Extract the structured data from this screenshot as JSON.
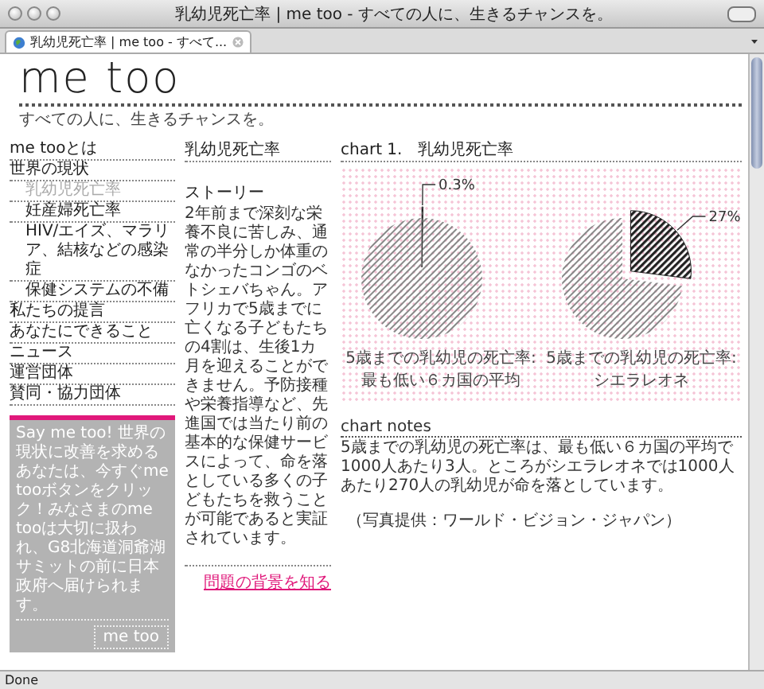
{
  "window": {
    "title": "乳幼児死亡率 | me too - すべての人に、生きるチャンスを。"
  },
  "tabs": [
    {
      "label": "乳幼児死亡率 | me too - すべて...",
      "selected": true
    }
  ],
  "header": {
    "logo": "me too",
    "tagline": "すべての人に、生きるチャンスを。"
  },
  "nav": [
    {
      "label": "me tooとは",
      "selected": false
    },
    {
      "label": "世界の現状",
      "selected": false,
      "children": [
        {
          "label": "乳幼児死亡率",
          "selected": true
        },
        {
          "label": "妊産婦死亡率",
          "selected": false
        },
        {
          "label": "HIV/エイズ、マラリア、結核などの感染症",
          "selected": false
        },
        {
          "label": "保健システムの不備",
          "selected": false
        }
      ]
    },
    {
      "label": "私たちの提言",
      "selected": false
    },
    {
      "label": "あなたにできること",
      "selected": false
    },
    {
      "label": "ニュース",
      "selected": false
    },
    {
      "label": "運営団体",
      "selected": false
    },
    {
      "label": "賛同・協力団体",
      "selected": false
    }
  ],
  "sidebar_box": {
    "text": "Say me too! 世界の現状に改善を求めるあなたは、今すぐme tooボタンをクリック！みなさまのme tooは大切に扱われ、G8北海道洞爺湖サミットの前に日本政府へ届けられます。",
    "button": "me too"
  },
  "story": {
    "heading": "乳幼児死亡率",
    "title": "ストーリー",
    "text": "2年前まで深刻な栄養不良に苦しみ、通常の半分しか体重のなかったコンゴのベトシェバちゃん。アフリカで5歳までに亡くなる子どもたちの4割は、生後1カ月を迎えることができません。予防接種や栄養指導など、先進国では当たり前の基本的な保健サービスによって、命を落としている多くの子どもたちを救うことが可能であると実証されています。",
    "link": "問題の背景を知る"
  },
  "chart_panel": {
    "title": "chart 1.　乳幼児死亡率",
    "charts": [
      {
        "caption": [
          "5歳までの乳幼児の死亡率:",
          "最も低い６カ国の平均"
        ],
        "chart_data": {
          "type": "pie",
          "values": [
            0.3,
            99.7
          ],
          "value_labels": [
            "0.3%",
            null
          ]
        }
      },
      {
        "caption": [
          "5歳までの乳幼児の死亡率:",
          "シエラレオネ"
        ],
        "chart_data": {
          "type": "pie",
          "values": [
            27,
            73
          ],
          "value_labels": [
            "27%",
            null
          ]
        }
      }
    ],
    "notes_heading": "chart notes",
    "notes": "5歳までの乳幼児の死亡率は、最も低い６カ国の平均で1000人あたり3人。ところがシエラレオネでは1000人あたり270人の乳幼児が命を落としています。",
    "credit": "（写真提供：ワールド・ビジョン・ジャパン）"
  },
  "status_bar": "Done"
}
